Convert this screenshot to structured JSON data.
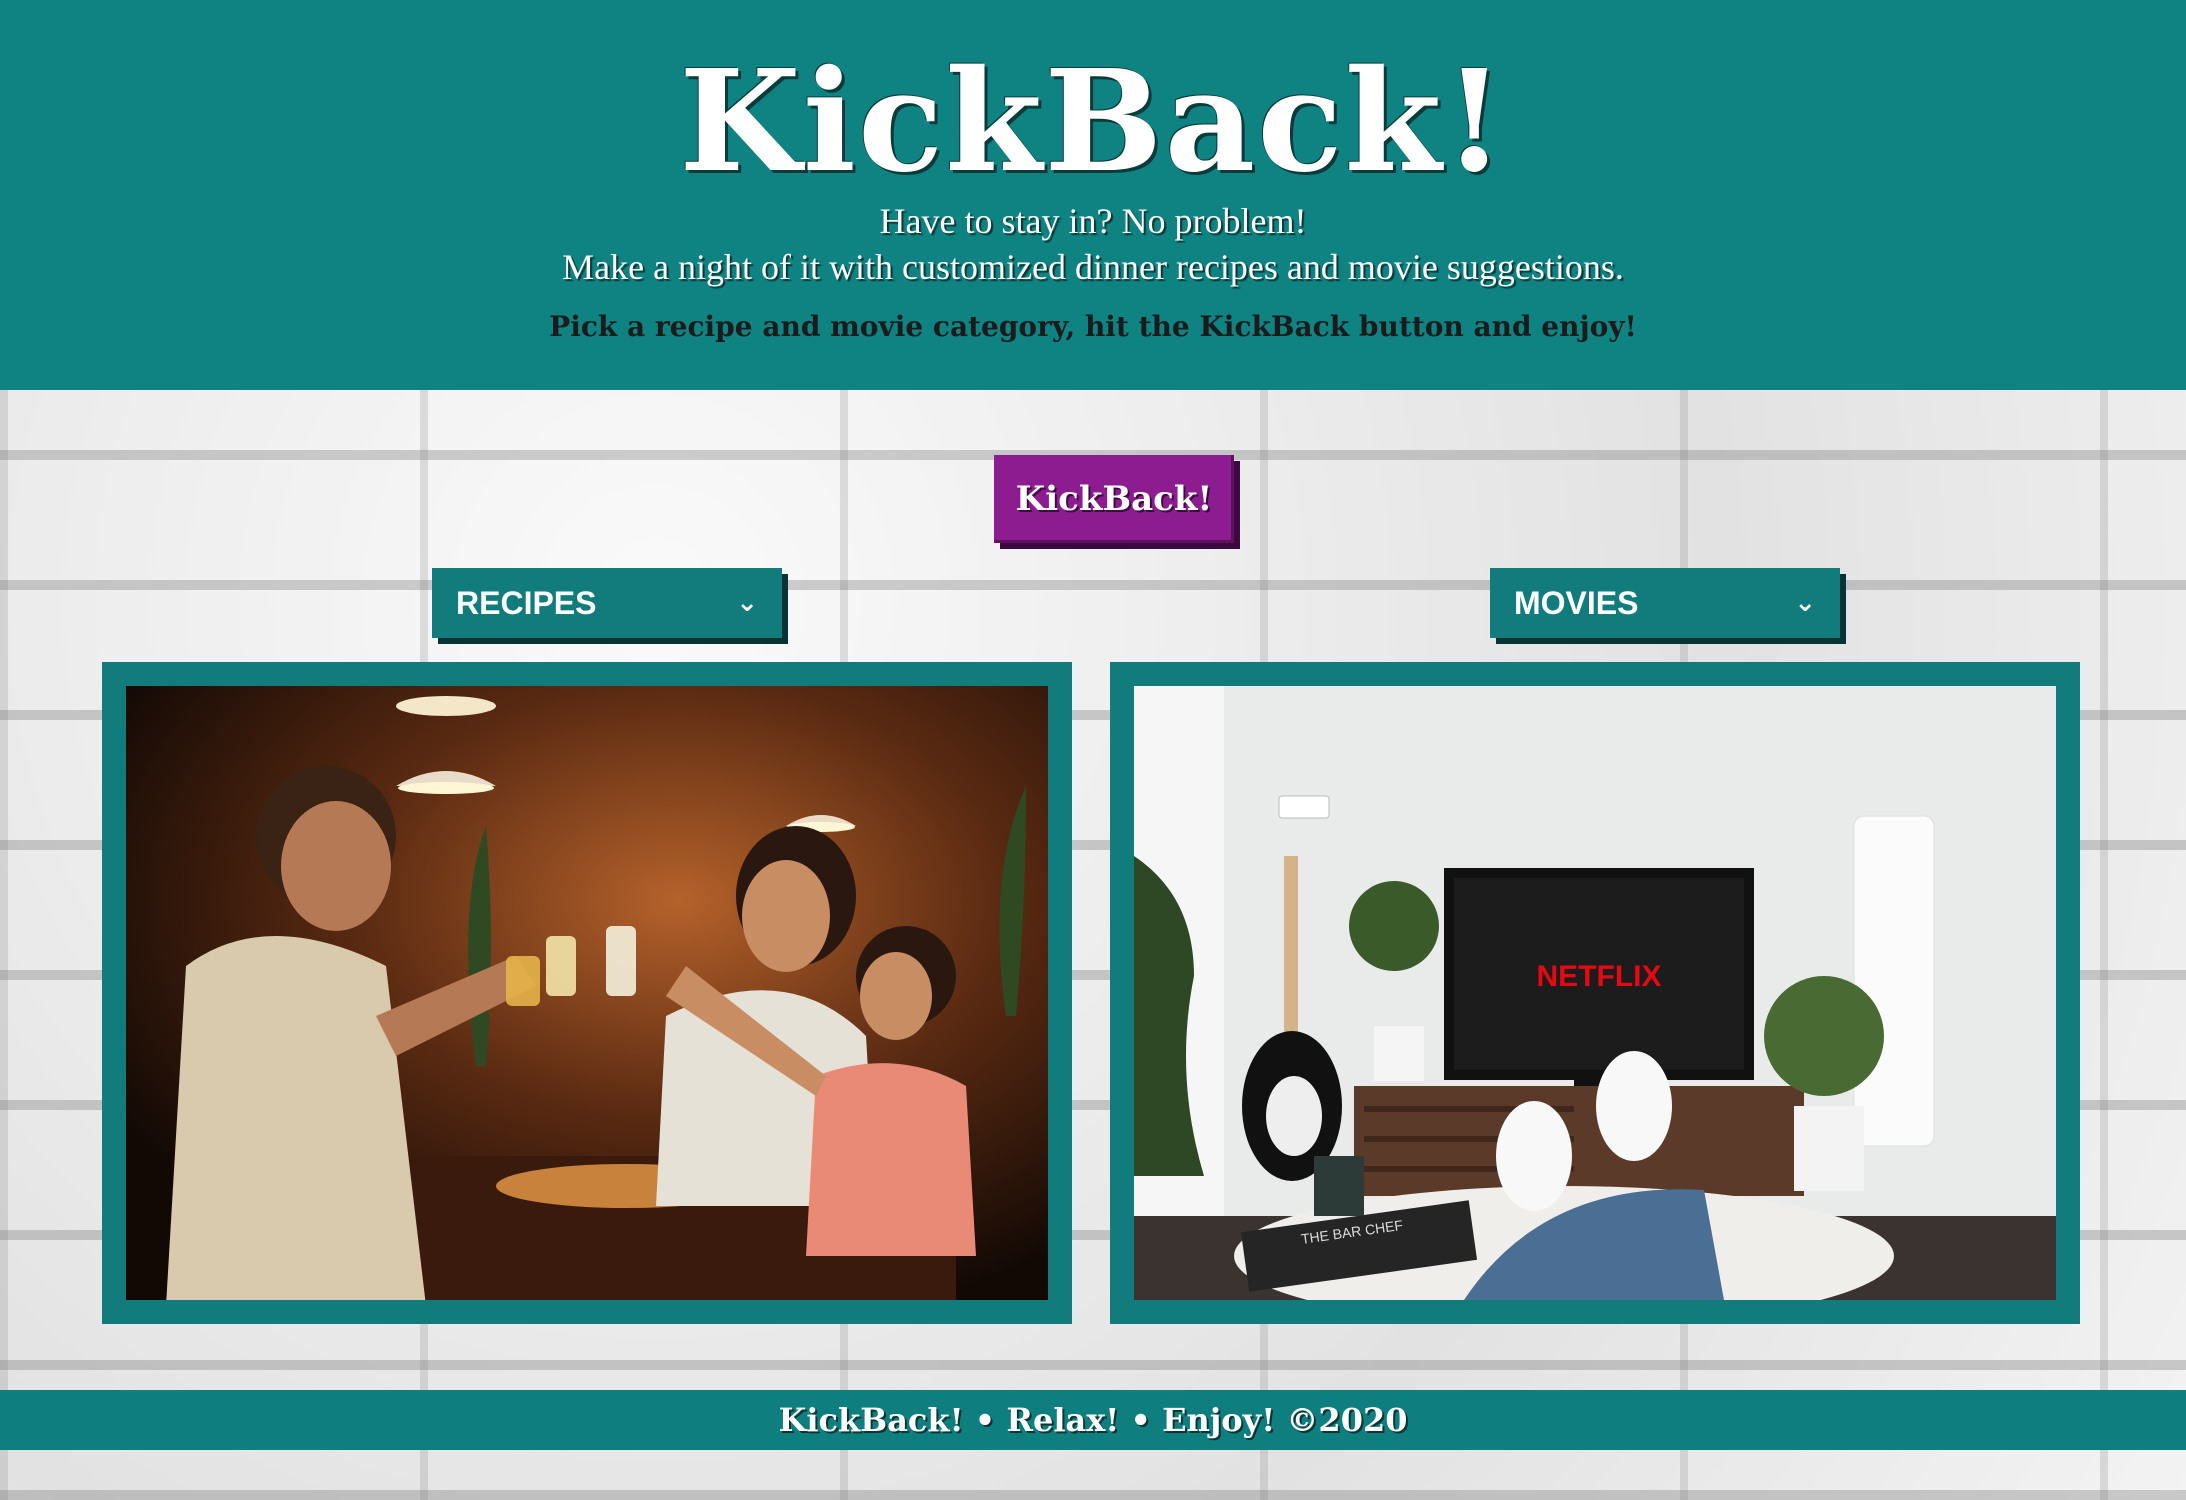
{
  "header": {
    "brand": "KickBack!",
    "tagline_line1": "Have to stay in? No problem!",
    "tagline_line2": "Make a night of it with customized dinner recipes and movie suggestions.",
    "instructions": "Pick a recipe and movie category, hit the KickBack button and enjoy!"
  },
  "button": {
    "label": "KickBack!"
  },
  "selects": {
    "recipes": {
      "selected": "RECIPES"
    },
    "movies": {
      "selected": "MOVIES"
    }
  },
  "images": {
    "recipes": {
      "icon": "family-dinner-photo"
    },
    "movies": {
      "icon": "tv-netflix-photo",
      "tv_text": "NETFLIX",
      "book_title": "THE BAR CHEF"
    }
  },
  "footer": {
    "text": "KickBack! • Relax! • Enjoy! ©2020"
  },
  "colors": {
    "teal": "#0f8282",
    "purple": "#8c1c8f",
    "netflix_red": "#e50914"
  }
}
